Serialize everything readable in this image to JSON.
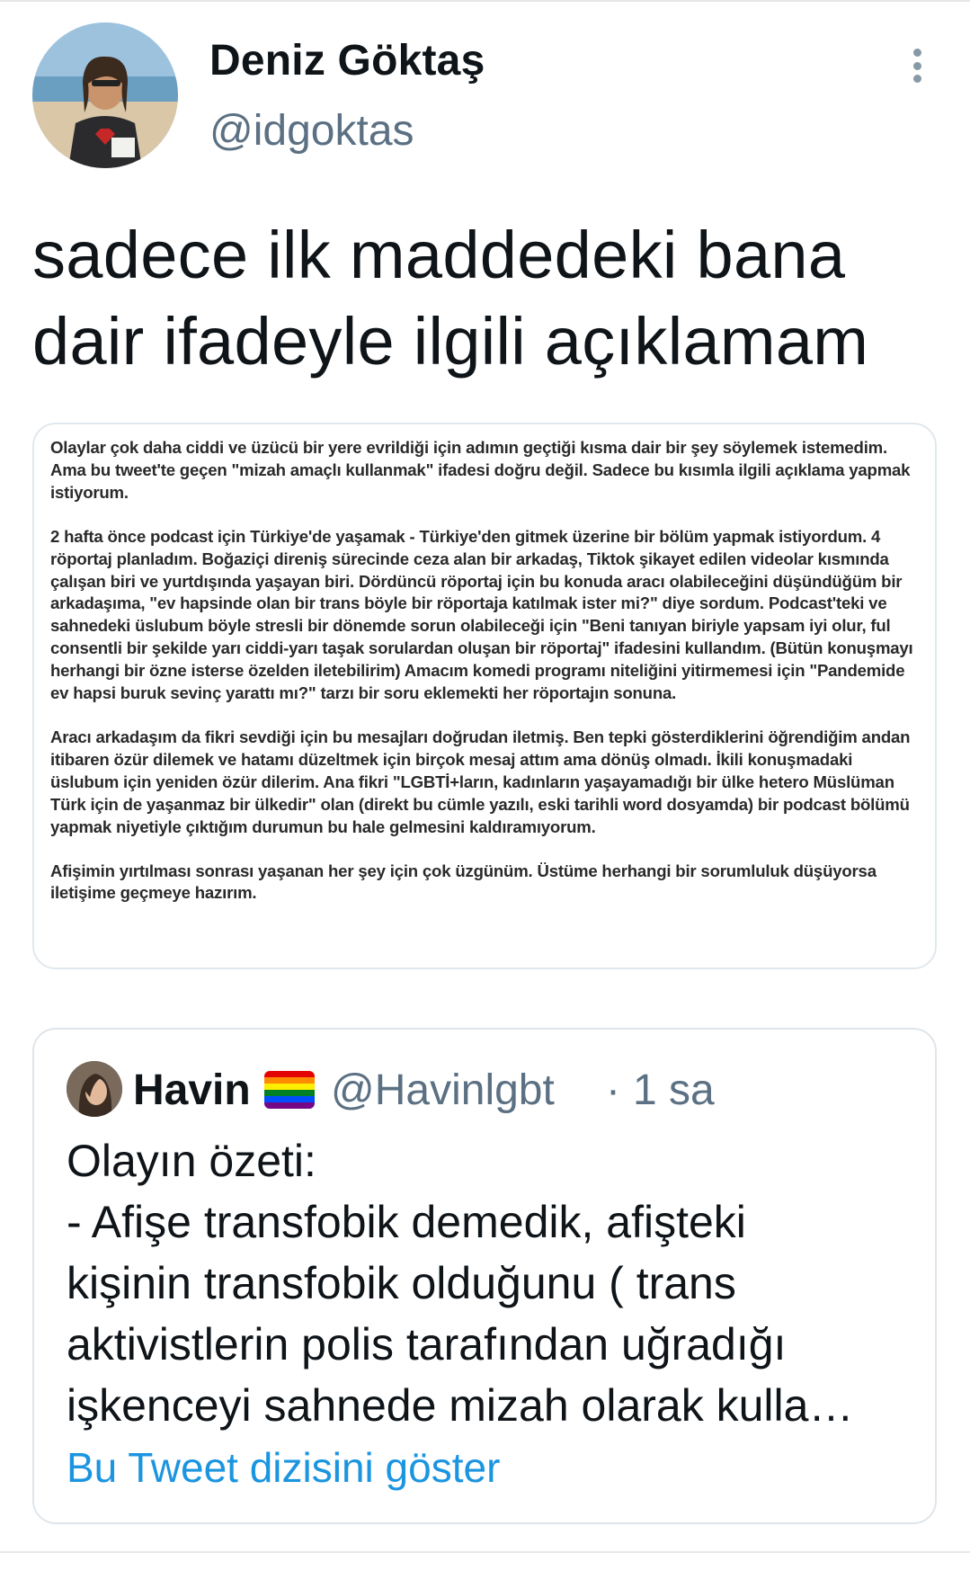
{
  "author": {
    "display_name": "Deniz Göktaş",
    "handle": "@idgoktas"
  },
  "tweet": {
    "text": "sadece ilk maddedeki bana dair ifadeyle ilgili açıklamam"
  },
  "note": {
    "paragraphs": [
      "Olaylar çok daha ciddi ve üzücü bir yere evrildiği için adımın geçtiği kısma dair bir şey söylemek istemedim. Ama bu tweet'te geçen \"mizah amaçlı kullanmak\" ifadesi doğru değil. Sadece bu kısımla ilgili açıklama yapmak istiyorum.",
      "2 hafta önce podcast için Türkiye'de yaşamak - Türkiye'den gitmek üzerine bir bölüm yapmak istiyordum. 4 röportaj planladım. Boğaziçi direniş sürecinde ceza alan bir arkadaş, Tiktok şikayet edilen videolar kısmında çalışan biri ve yurtdışında yaşayan biri. Dördüncü röportaj için bu konuda aracı olabileceğini düşündüğüm bir arkadaşıma, \"ev hapsinde olan bir trans böyle bir röportaja katılmak ister mi?\" diye sordum. Podcast'teki ve sahnedeki üslubum böyle stresli bir dönemde sorun olabileceği için \"Beni tanıyan biriyle yapsam iyi olur, ful consentli bir şekilde yarı ciddi-yarı taşak sorulardan oluşan bir röportaj\" ifadesini kullandım. (Bütün konuşmayı herhangi bir özne isterse özelden iletebilirim) Amacım komedi programı niteliğini yitirmemesi için \"Pandemide ev hapsi buruk sevinç yarattı mı?\" tarzı bir soru eklemekti her röportajın sonuna.",
      "Aracı arkadaşım da fikri sevdiği için bu mesajları doğrudan iletmiş. Ben tepki gösterdiklerini öğrendiğim andan itibaren özür dilemek ve hatamı düzeltmek için birçok mesaj attım ama dönüş olmadı. İkili konuşmadaki üslubum için yeniden özür dilerim. Ana fikri \"LGBTİ+ların, kadınların yaşayamadığı bir ülke hetero Müslüman Türk için de yaşanmaz bir ülkedir\" olan (direkt bu cümle yazılı, eski tarihli word dosyamda) bir podcast bölümü yapmak niyetiyle çıktığım durumun bu hale gelmesini kaldıramıyorum.",
      "Afişimin yırtılması sonrası yaşanan her şey için çok üzgünüm. Üstüme herhangi bir sorumluluk düşüyorsa iletişime geçmeye hazırım."
    ]
  },
  "quoted": {
    "display_name": "Havin",
    "handle": "@Havinlgbt",
    "separator": "·",
    "time": "1 sa",
    "text_lines": [
      "Olayın özeti:",
      "- Afişe transfobik demedik, afişteki",
      "kişinin transfobik olduğunu ( trans",
      "aktivistlerin polis tarafından uğradığı",
      "işkenceyi sahnede mizah olarak kulla…"
    ],
    "show_thread_label": "Bu Tweet dizisini göster",
    "flag_icon": "rainbow-flag-icon",
    "flag_colors": [
      "#e40303",
      "#ff8c00",
      "#ffed00",
      "#008026",
      "#004dff",
      "#750787"
    ]
  },
  "colors": {
    "link": "#1b95e0",
    "secondary_text": "#5b7083",
    "border": "#e1e8ed"
  }
}
